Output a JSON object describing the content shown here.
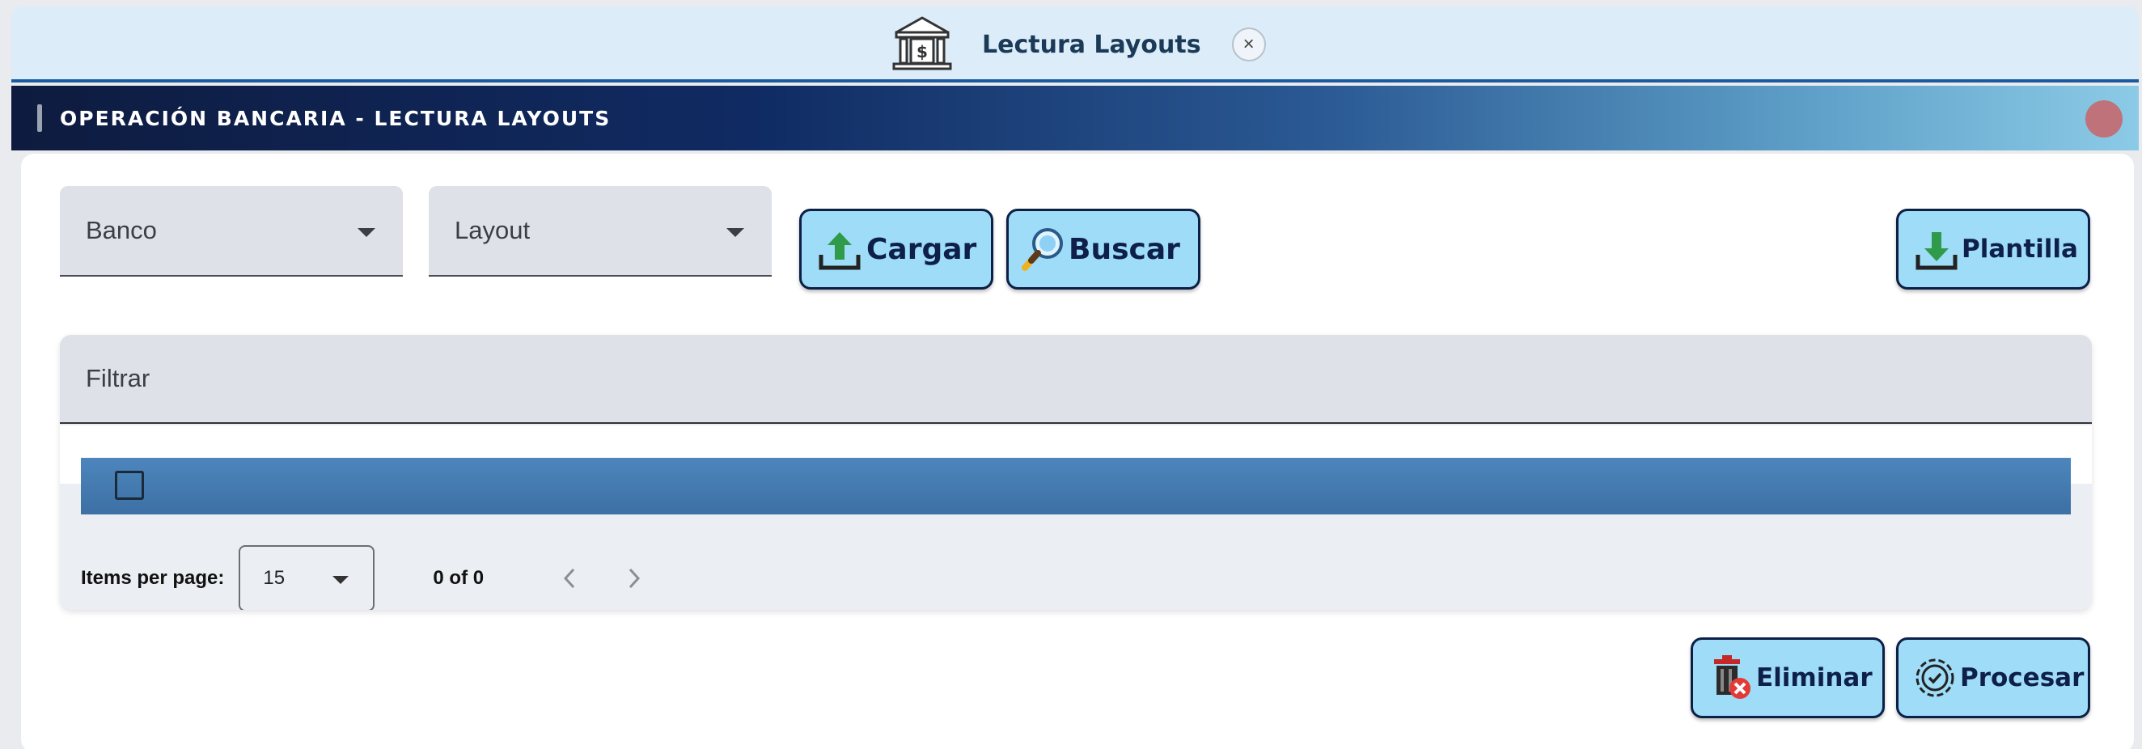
{
  "tab": {
    "title": "Lectura Layouts",
    "icon": "bank-icon",
    "close_icon": "close-icon",
    "close_symbol": "×"
  },
  "header": {
    "title": "OPERACIÓN BANCARIA - LECTURA LAYOUTS"
  },
  "toolbar": {
    "banco": {
      "placeholder": "Banco",
      "value": ""
    },
    "layout": {
      "placeholder": "Layout",
      "value": ""
    },
    "cargar_label": "Cargar",
    "buscar_label": "Buscar",
    "plantilla_label": "Plantilla"
  },
  "table": {
    "filter_placeholder": "Filtrar",
    "columns": [],
    "rows": []
  },
  "paginator": {
    "items_per_page_label": "Items per page:",
    "items_per_page_value": "15",
    "range_label": "0 of 0"
  },
  "actions": {
    "eliminar_label": "Eliminar",
    "procesar_label": "Procesar"
  },
  "colors": {
    "button_bg": "#9edcf7",
    "button_border": "#0c1f45",
    "header_gradient_start": "#0e1b3f",
    "header_gradient_end": "#8ccbe6",
    "table_header": "#4c86bd",
    "status_dot": "#c0727a"
  }
}
